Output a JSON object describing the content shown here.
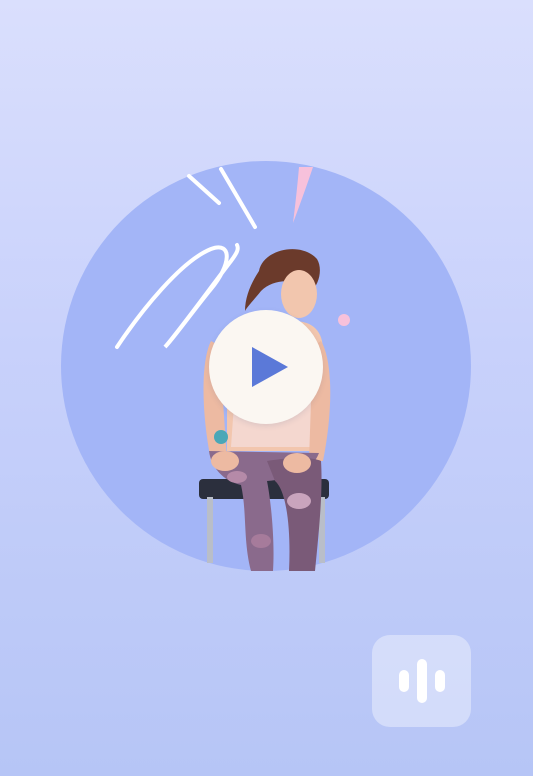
{
  "player": {
    "play_icon": "play-icon",
    "audio_icon": "equalizer-icon"
  },
  "colors": {
    "background_top": "#dadffd",
    "background_bottom": "#b6c5f6",
    "circle": "#a3b5f7",
    "play_button": "#fbf7f2",
    "play_glyph": "#5b79d8",
    "accent_pink": "#f7c1db"
  }
}
